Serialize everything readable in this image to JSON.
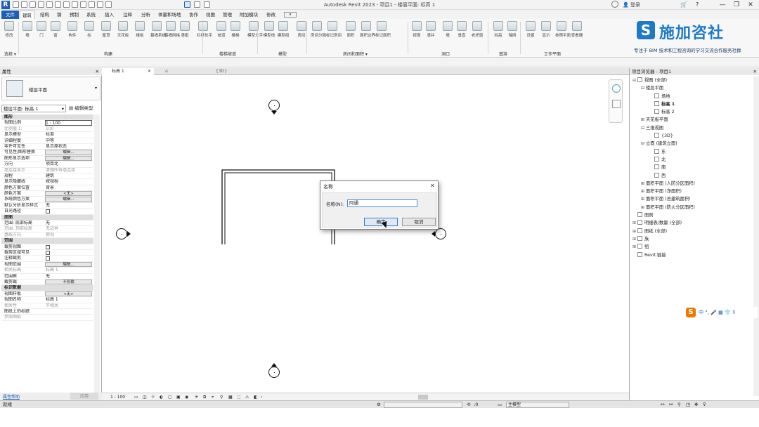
{
  "titlebar": {
    "logo": "R",
    "window_title": "Autodesk Revit 2023 - 项目1 - 楼层平面: 标高 1",
    "user": "登录",
    "win_min": "—",
    "win_restore": "❐",
    "win_close": "✕"
  },
  "menu": {
    "tabs": [
      "文件",
      "建筑",
      "结构",
      "钢",
      "预制",
      "系统",
      "插入",
      "注释",
      "分析",
      "体量和场地",
      "协作",
      "视图",
      "管理",
      "附加模块",
      "修改"
    ]
  },
  "ribbon": {
    "buttons": [
      "修改",
      "墙",
      "门",
      "窗",
      "构件",
      "柱",
      "屋顶",
      "天花板",
      "楼板",
      "幕墙系统",
      "幕墙网格",
      "竖梃",
      "栏杆扶手",
      "坡道",
      "楼梯",
      "模型文字",
      "模型线",
      "模型组",
      "房间",
      "房间分隔",
      "标记房间",
      "面积",
      "面积边界",
      "标记面积",
      "按面",
      "竖井",
      "墙",
      "垂直",
      "老虎窗",
      "标高",
      "轴网",
      "设置",
      "显示",
      "参照平面",
      "查看器"
    ],
    "panels": [
      "选择 ▾",
      "构建",
      "楼梯坡道",
      "模型",
      "房间和面积 ▾",
      "洞口",
      "基准",
      "工作平面"
    ]
  },
  "brand": {
    "logo_letter": "S",
    "name": "施加咨社",
    "tagline": "专注于 BIM 技术和工程咨询的学习交流合作服务社群"
  },
  "properties": {
    "title": "属性",
    "type_name": "楼层平面",
    "filter": "楼层平面: 标高 1",
    "edit_type": "编辑类型",
    "rows": [
      {
        "k": "图形",
        "v": "",
        "hdr": true
      },
      {
        "k": "视图比例",
        "v": "1 : 100",
        "input": true
      },
      {
        "k": "比例值 1:",
        "v": "100",
        "grey": true
      },
      {
        "k": "显示模型",
        "v": "标准"
      },
      {
        "k": "详细程度",
        "v": "中等"
      },
      {
        "k": "零件可见性",
        "v": "显示原状态"
      },
      {
        "k": "可见性/图形替换",
        "v": "编辑...",
        "btn": true
      },
      {
        "k": "图形显示选项",
        "v": "编辑...",
        "btn": true
      },
      {
        "k": "方向",
        "v": "项目北"
      },
      {
        "k": "墙连接显示",
        "v": "清理所有墙连接",
        "grey": true
      },
      {
        "k": "规程",
        "v": "建筑"
      },
      {
        "k": "显示隐藏线",
        "v": "按规程"
      },
      {
        "k": "颜色方案位置",
        "v": "背景"
      },
      {
        "k": "颜色方案",
        "v": "<无>",
        "btn": true
      },
      {
        "k": "系统颜色方案",
        "v": "编辑...",
        "btn": true
      },
      {
        "k": "默认分析显示样式",
        "v": "无"
      },
      {
        "k": "日光路径",
        "v": "",
        "chk": true
      },
      {
        "k": "底图",
        "v": "",
        "hdr": true
      },
      {
        "k": "范围: 底部标高",
        "v": "无"
      },
      {
        "k": "范围: 顶部标高",
        "v": "无边界",
        "grey": true
      },
      {
        "k": "基线方向",
        "v": "俯视",
        "grey": true
      },
      {
        "k": "范围",
        "v": "",
        "hdr": true
      },
      {
        "k": "裁剪视图",
        "v": "",
        "chk": true
      },
      {
        "k": "裁剪区域可见",
        "v": "",
        "chk": true
      },
      {
        "k": "注释裁剪",
        "v": "",
        "chk": true
      },
      {
        "k": "视图范围",
        "v": "编辑...",
        "btn": true
      },
      {
        "k": "相关标高",
        "v": "标高 1",
        "grey": true
      },
      {
        "k": "范围框",
        "v": "无"
      },
      {
        "k": "截剪裁",
        "v": "不剪裁",
        "btn": true
      },
      {
        "k": "标识数据",
        "v": "",
        "hdr": true
      },
      {
        "k": "视图样板",
        "v": "<无>",
        "btn": true
      },
      {
        "k": "视图名称",
        "v": "标高 1"
      },
      {
        "k": "相关性",
        "v": "不相关",
        "grey": true
      },
      {
        "k": "图纸上的标题",
        "v": ""
      },
      {
        "k": "参照图纸",
        "v": "",
        "grey": true
      }
    ],
    "help_link": "属性帮助",
    "apply": "应用"
  },
  "view": {
    "tabs": [
      "标高 1",
      "",
      "{3D}"
    ],
    "scale": "1 : 100",
    "zero": "0"
  },
  "dialog": {
    "title": "名称",
    "close": "✕",
    "label": "名称(N):",
    "value": "阿通",
    "ok": "确定",
    "cancel": "取消"
  },
  "browser": {
    "title": "项目浏览器 - 项目1",
    "nodes": [
      {
        "t": "视图 (全部)",
        "d": 0,
        "tw": "⊟",
        "icon": true
      },
      {
        "t": "楼层平面",
        "d": 1,
        "tw": "⊟"
      },
      {
        "t": "场地",
        "d": 2,
        "tw": "",
        "box": true
      },
      {
        "t": "标高 1",
        "d": 2,
        "tw": "",
        "box": true,
        "bold": true
      },
      {
        "t": "标高 2",
        "d": 2,
        "tw": "",
        "box": true
      },
      {
        "t": "天花板平面",
        "d": 1,
        "tw": "⊞"
      },
      {
        "t": "三维视图",
        "d": 1,
        "tw": "⊟"
      },
      {
        "t": "{3D}",
        "d": 2,
        "tw": "",
        "box": true
      },
      {
        "t": "立面 (建筑立面)",
        "d": 1,
        "tw": "⊟"
      },
      {
        "t": "东",
        "d": 2,
        "tw": "",
        "box": true
      },
      {
        "t": "北",
        "d": 2,
        "tw": "",
        "box": true
      },
      {
        "t": "南",
        "d": 2,
        "tw": "",
        "box": true
      },
      {
        "t": "西",
        "d": 2,
        "tw": "",
        "box": true
      },
      {
        "t": "面积平面 (人防分区面积)",
        "d": 1,
        "tw": "⊞"
      },
      {
        "t": "面积平面 (净面积)",
        "d": 1,
        "tw": "⊞"
      },
      {
        "t": "面积平面 (总建筑面积)",
        "d": 1,
        "tw": "⊞"
      },
      {
        "t": "面积平面 (防火分区面积)",
        "d": 1,
        "tw": "⊞"
      },
      {
        "t": "图例",
        "d": 0,
        "tw": "",
        "icon": true
      },
      {
        "t": "明细表/数量 (全部)",
        "d": 0,
        "tw": "⊞",
        "icon": true
      },
      {
        "t": "图纸 (全部)",
        "d": 0,
        "tw": "⊞",
        "icon": true
      },
      {
        "t": "族",
        "d": 0,
        "tw": "⊞",
        "icon": true
      },
      {
        "t": "组",
        "d": 0,
        "tw": "⊞",
        "icon": true
      },
      {
        "t": "Revit 链接",
        "d": 0,
        "tw": "",
        "icon": true
      }
    ]
  },
  "ime": {
    "logo": "S",
    "text": "中 °, 🎤 ▦ 👕 ⠿"
  },
  "status": {
    "left": "就绪",
    "zero": ":0",
    "model": "主模型"
  }
}
